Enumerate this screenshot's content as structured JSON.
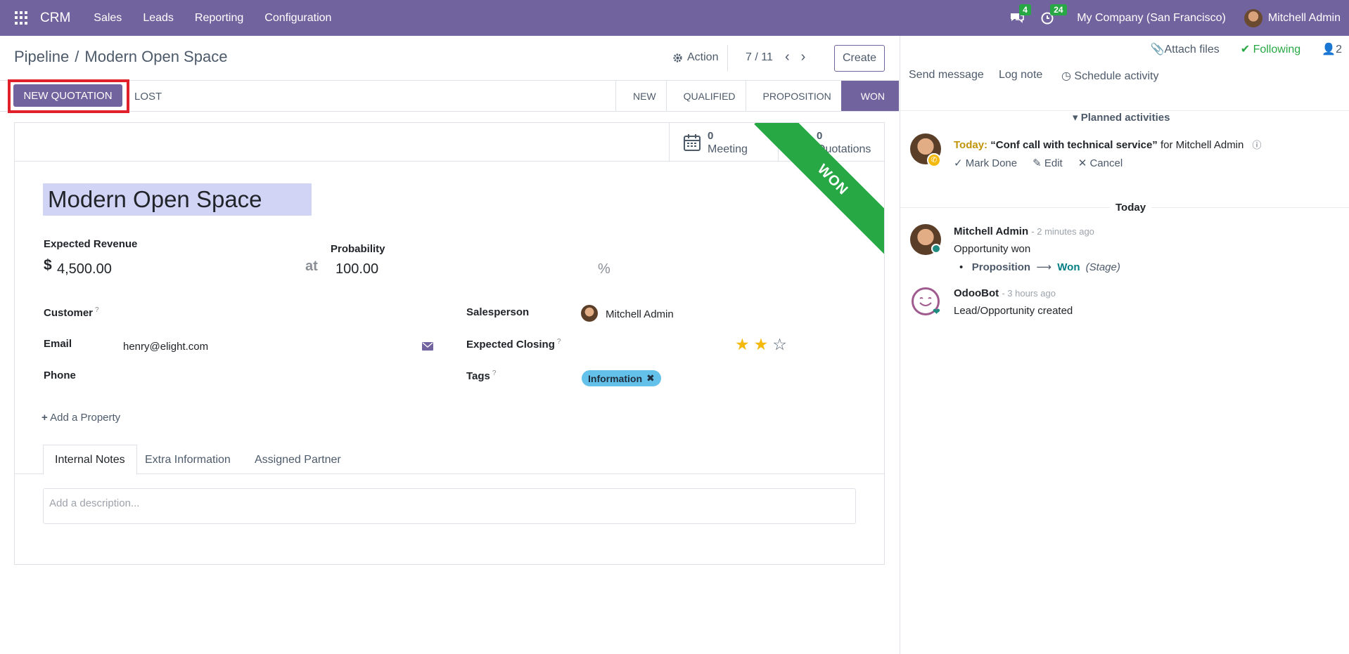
{
  "navbar": {
    "brand": "CRM",
    "menu": [
      "Sales",
      "Leads",
      "Reporting",
      "Configuration"
    ],
    "messages_count": "4",
    "activities_count": "24",
    "company": "My Company (San Francisco)",
    "user": "Mitchell Admin"
  },
  "control_panel": {
    "breadcrumb_parent": "Pipeline",
    "breadcrumb_separator": "/",
    "breadcrumb_current": "Modern Open Space",
    "action_label": "Action",
    "pager": "7 / 11",
    "create_label": "Create"
  },
  "statusbar": {
    "new_quotation": "NEW QUOTATION",
    "lost": "LOST",
    "stages": [
      "NEW",
      "QUALIFIED",
      "PROPOSITION",
      "WON"
    ],
    "active_stage": "WON"
  },
  "smart_buttons": {
    "meeting_count": "0",
    "meeting_label": "Meeting",
    "quotations_count": "0",
    "quotations_label": "Quotations"
  },
  "ribbon": "WON",
  "form": {
    "title": "Modern Open Space",
    "expected_revenue_label": "Expected Revenue",
    "currency": "$",
    "expected_revenue": "4,500.00",
    "at": "at",
    "probability_label": "Probability",
    "probability": "100.00",
    "percent": "%",
    "customer_label": "Customer",
    "email_label": "Email",
    "email": "henry@elight.com",
    "phone_label": "Phone",
    "salesperson_label": "Salesperson",
    "salesperson": "Mitchell Admin",
    "expected_closing_label": "Expected Closing",
    "priority_stars": 2,
    "priority_max": 3,
    "tags_label": "Tags",
    "tag": "Information",
    "add_property": "Add a Property",
    "help_marker": "?",
    "tabs": [
      "Internal Notes",
      "Extra Information",
      "Assigned Partner"
    ],
    "description_placeholder": "Add a description..."
  },
  "chatter": {
    "attach_files": "Attach files",
    "following": "Following",
    "followers_count": "2",
    "send_message": "Send message",
    "log_note": "Log note",
    "schedule_activity": "Schedule activity",
    "planned_activities": "Planned activities",
    "activity_today": "Today:",
    "activity_title": "“Conf call with technical service”",
    "activity_for": "for Mitchell Admin",
    "mark_done": "Mark Done",
    "edit": "Edit",
    "cancel": "Cancel",
    "today_separator": "Today",
    "messages": [
      {
        "author": "Mitchell Admin",
        "time": "- 2 minutes ago",
        "body": "Opportunity won",
        "change_from": "Proposition",
        "change_to": "Won",
        "change_field": "(Stage)"
      },
      {
        "author": "OdooBot",
        "time": "- 3 hours ago",
        "body": "Lead/Opportunity created"
      }
    ]
  }
}
